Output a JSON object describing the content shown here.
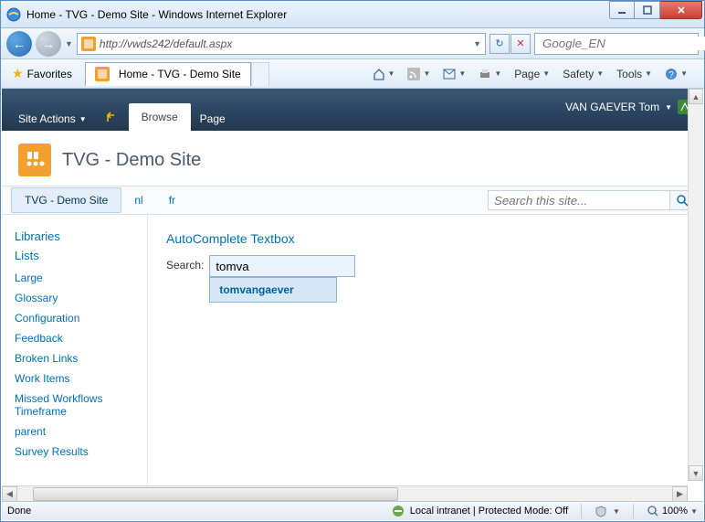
{
  "window": {
    "title": "Home - TVG - Demo Site - Windows Internet Explorer"
  },
  "nav": {
    "url": "http://vwds242/default.aspx",
    "search_placeholder": "Google_EN"
  },
  "favbar": {
    "favorites": "Favorites",
    "tab_title": "Home - TVG - Demo Site"
  },
  "cmdbar": {
    "page": "Page",
    "safety": "Safety",
    "tools": "Tools"
  },
  "ribbon": {
    "site_actions": "Site Actions",
    "browse": "Browse",
    "page": "Page",
    "user": "VAN GAEVER Tom"
  },
  "site": {
    "title": "TVG - Demo Site",
    "tabs": [
      "TVG - Demo Site",
      "nl",
      "fr"
    ],
    "search_placeholder": "Search this site..."
  },
  "leftnav": {
    "libraries": "Libraries",
    "lists": "Lists",
    "items": [
      "Large",
      "Glossary",
      "Configuration",
      "Feedback",
      "Broken Links",
      "Work Items",
      "Missed Workflows Timeframe",
      "parent",
      "Survey Results"
    ]
  },
  "content": {
    "heading": "AutoComplete Textbox",
    "search_label": "Search:",
    "search_value": "tomva",
    "suggestion": "tomvangaever"
  },
  "status": {
    "done": "Done",
    "zone": "Local intranet | Protected Mode: Off",
    "zoom": "100%"
  }
}
